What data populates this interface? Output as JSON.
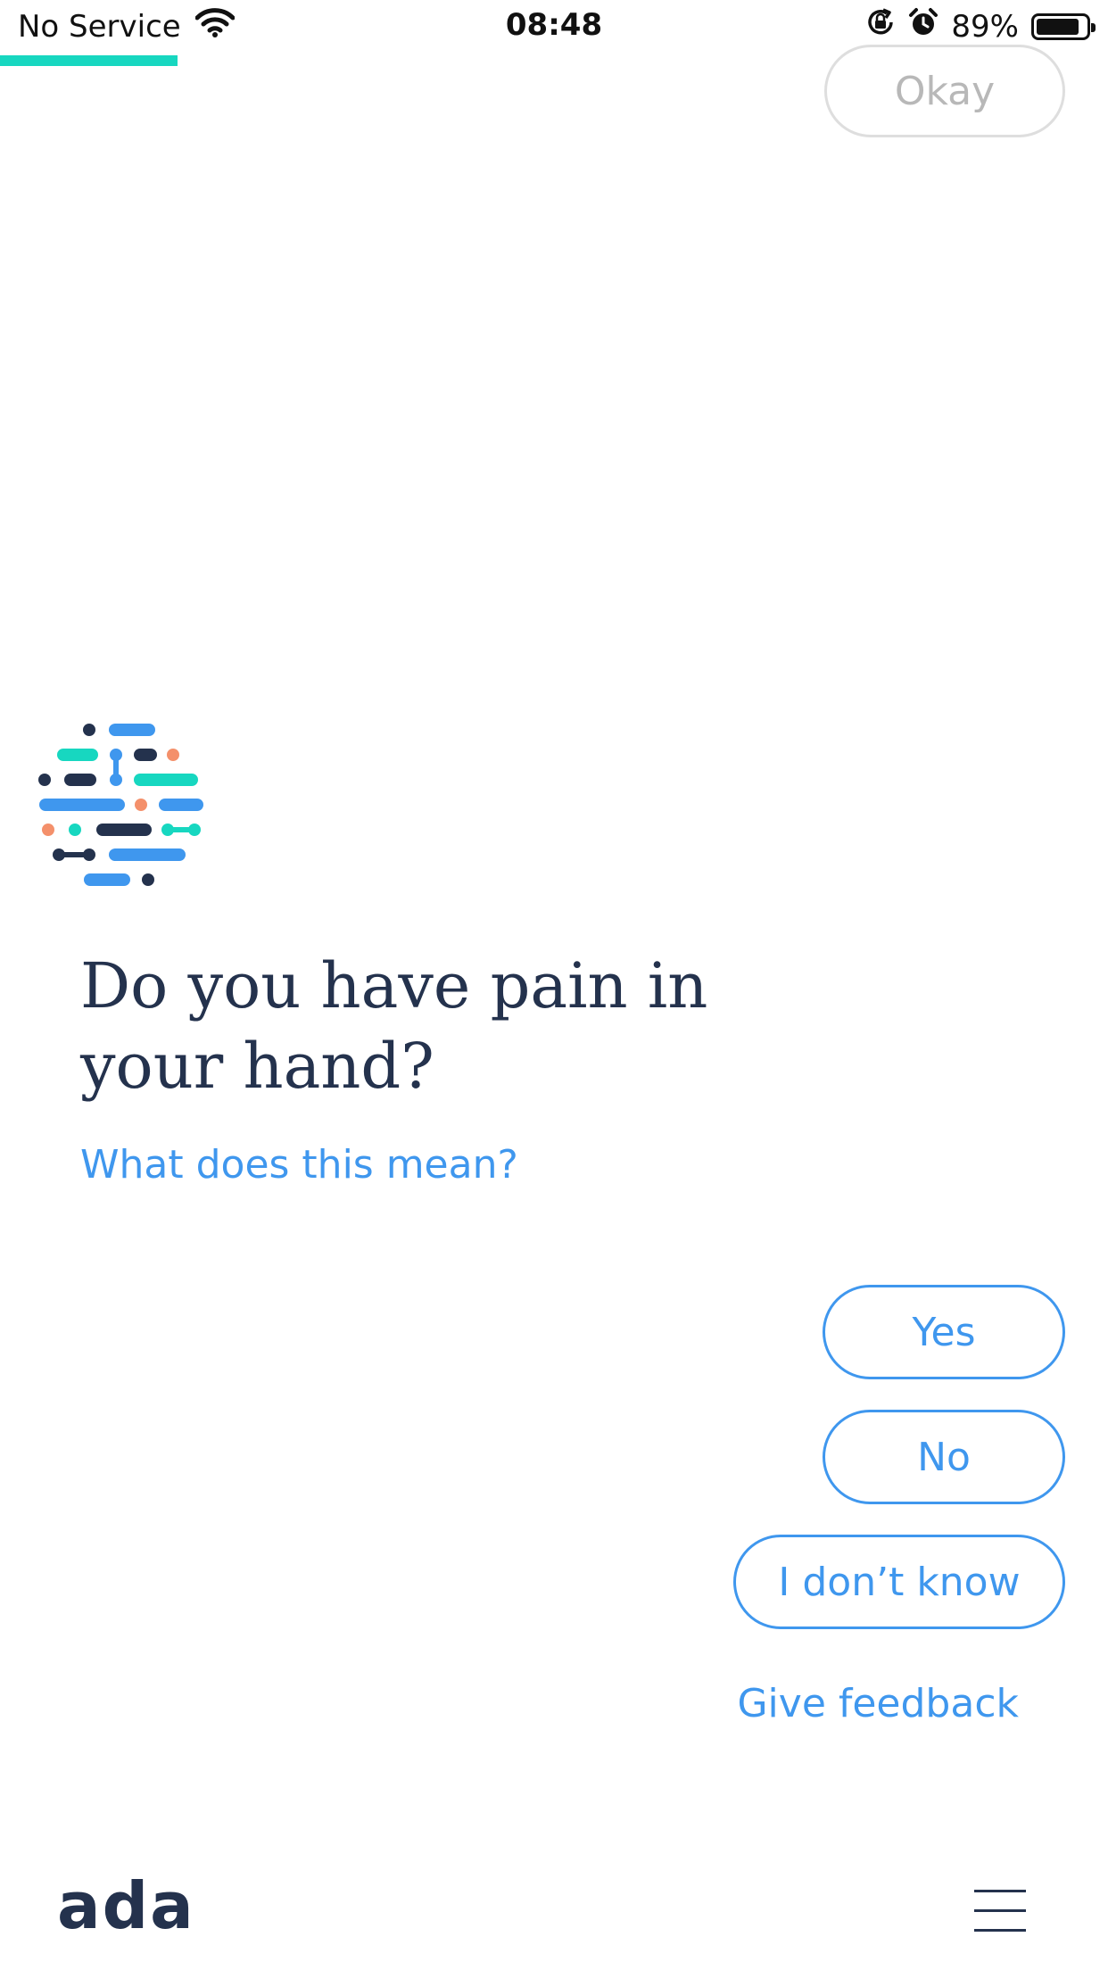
{
  "status_bar": {
    "carrier": "No Service",
    "time": "08:48",
    "battery_percent": "89%",
    "battery_level": 0.89,
    "icons": [
      "wifi-icon",
      "rotation-lock-icon",
      "alarm-icon",
      "battery-icon"
    ]
  },
  "progress": {
    "value": 0.16,
    "color": "#17d7c0"
  },
  "previous_answer": {
    "label": "Okay"
  },
  "question": {
    "text": "Do you have pain in your hand?",
    "help_link": "What does this mean?"
  },
  "answers": {
    "yes": "Yes",
    "no": "No",
    "dont_know": "I don’t know"
  },
  "feedback": {
    "label": "Give feedback"
  },
  "footer": {
    "brand": "ada",
    "menu_icon": "hamburger-menu-icon"
  },
  "colors": {
    "accent": "#3f97ee",
    "navy": "#24324d",
    "teal": "#17d7c0",
    "coral": "#f4906b"
  }
}
